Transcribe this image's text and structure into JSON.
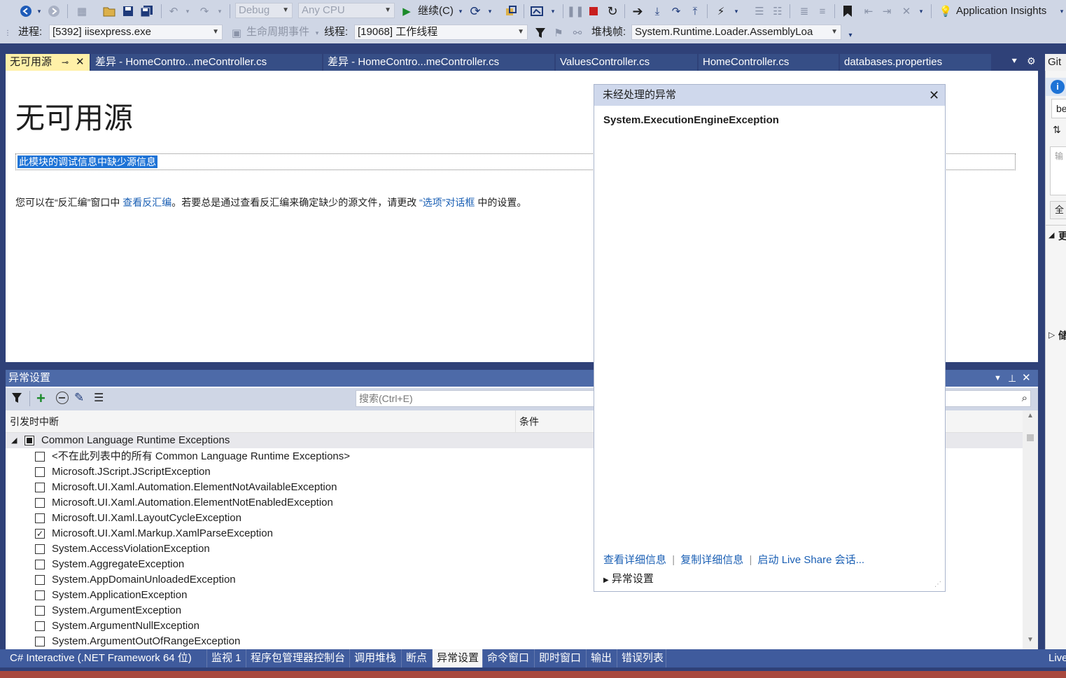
{
  "toolbar1": {
    "config": "Debug",
    "platform": "Any CPU",
    "continue_label": "继续(C)",
    "app_insights": "Application Insights"
  },
  "toolbar2": {
    "process_label": "进程:",
    "process_value": "[5392] iisexpress.exe",
    "lifecycle_label": "生命周期事件",
    "thread_label": "线程:",
    "thread_value": "[19068] 工作线程",
    "stackframe_label": "堆栈帧:",
    "stackframe_value": "System.Runtime.Loader.AssemblyLoa"
  },
  "tabs": [
    {
      "label": "无可用源",
      "active": true
    },
    {
      "label": "差异 - HomeContro...meController.cs"
    },
    {
      "label": "差异 - HomeContro...meController.cs"
    },
    {
      "label": "ValuesController.cs"
    },
    {
      "label": "HomeController.cs"
    },
    {
      "label": "databases.properties"
    }
  ],
  "git_tab": "Git",
  "document": {
    "title": "无可用源",
    "missing_info": "此模块的调试信息中缺少源信息",
    "desc_prefix": "您可以在“反汇编”窗口中 ",
    "desc_link1": "查看反汇编",
    "desc_middle": "。若要总是通过查看反汇编来确定缺少的源文件，请更改 ",
    "desc_link2": "“选项”对话框",
    "desc_suffix": " 中的设置。"
  },
  "exception_settings": {
    "title": "异常设置",
    "search_placeholder": "搜索(Ctrl+E)",
    "col_break": "引发时中断",
    "col_condition": "条件",
    "group": "Common Language Runtime Exceptions",
    "items": [
      {
        "label": "<不在此列表中的所有 Common Language Runtime Exceptions>",
        "checked": false
      },
      {
        "label": "Microsoft.JScript.JScriptException",
        "checked": false
      },
      {
        "label": "Microsoft.UI.Xaml.Automation.ElementNotAvailableException",
        "checked": false
      },
      {
        "label": "Microsoft.UI.Xaml.Automation.ElementNotEnabledException",
        "checked": false
      },
      {
        "label": "Microsoft.UI.Xaml.LayoutCycleException",
        "checked": false
      },
      {
        "label": "Microsoft.UI.Xaml.Markup.XamlParseException",
        "checked": true
      },
      {
        "label": "System.AccessViolationException",
        "checked": false
      },
      {
        "label": "System.AggregateException",
        "checked": false
      },
      {
        "label": "System.AppDomainUnloadedException",
        "checked": false
      },
      {
        "label": "System.ApplicationException",
        "checked": false
      },
      {
        "label": "System.ArgumentException",
        "checked": false
      },
      {
        "label": "System.ArgumentNullException",
        "checked": false
      },
      {
        "label": "System.ArgumentOutOfRangeException",
        "checked": false
      }
    ]
  },
  "popup": {
    "title": "未经处理的异常",
    "exception": "System.ExecutionEngineException",
    "link_details": "查看详细信息",
    "link_copy": "复制详细信息",
    "link_liveshare": "启动 Live Share 会话...",
    "exc_settings": "异常设置"
  },
  "bottom_tabs": [
    {
      "label": "C# Interactive (.NET Framework 64 位)"
    },
    {
      "label": "监视 1"
    },
    {
      "label": "程序包管理器控制台"
    },
    {
      "label": "调用堆栈"
    },
    {
      "label": "断点"
    },
    {
      "label": "异常设置",
      "active": true
    },
    {
      "label": "命令窗口"
    },
    {
      "label": "即时窗口"
    },
    {
      "label": "输出"
    },
    {
      "label": "错误列表"
    }
  ],
  "right_bottom_tab": "Live"
}
